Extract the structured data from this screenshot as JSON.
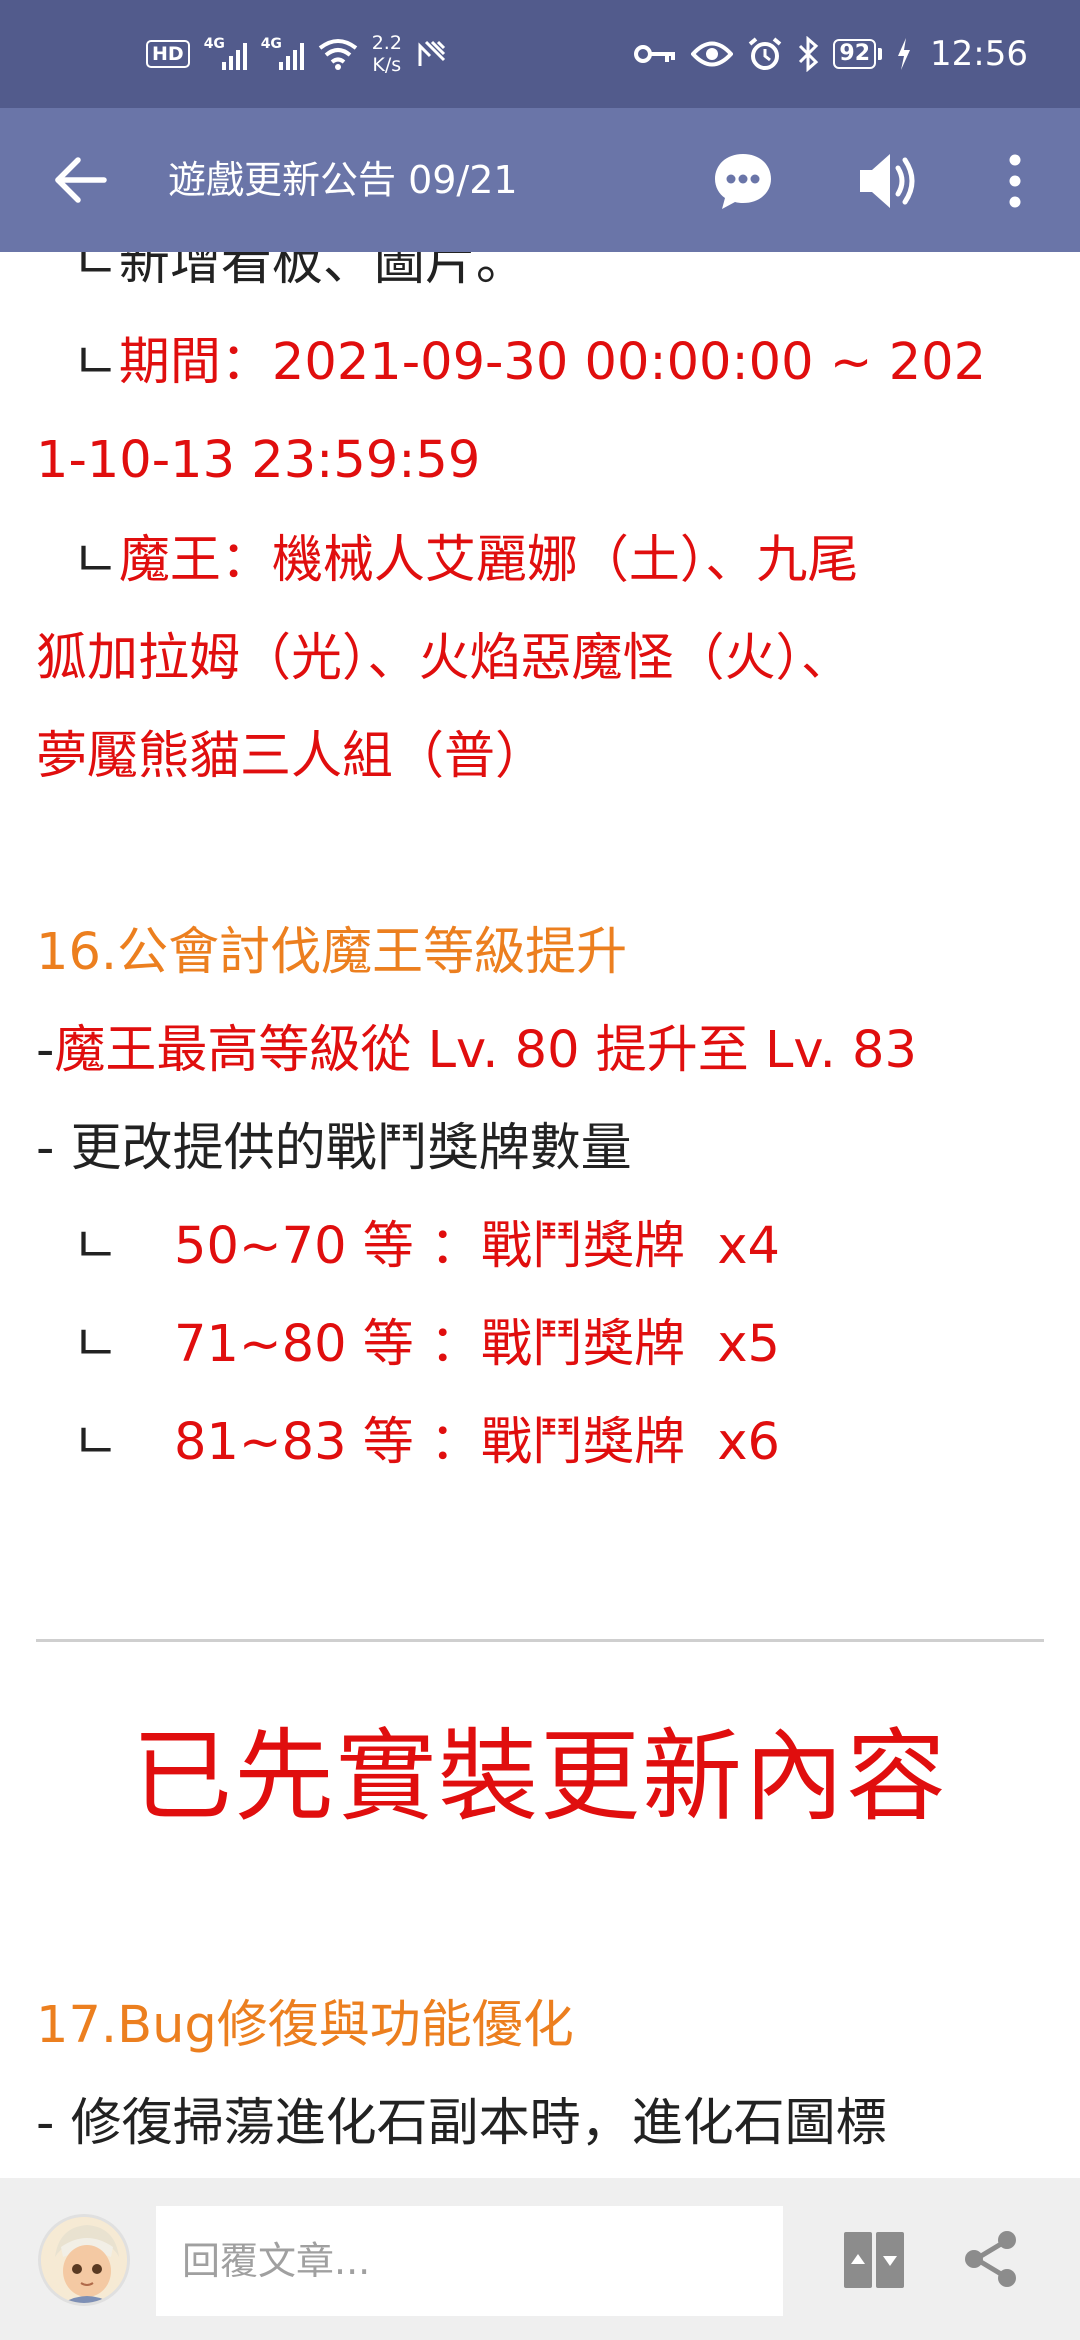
{
  "status_bar": {
    "hd_label": "HD",
    "sim1_label": "4G",
    "sim2_label": "4G",
    "speed_value": "2.2",
    "speed_unit": "K/s",
    "battery": "92",
    "time": "12:56"
  },
  "app_bar": {
    "title": "遊戲更新公告 09/21"
  },
  "article": {
    "partial_line": "ㄴ新增看板、圖片。",
    "period_prefix": "ㄴ",
    "period_line1": "期間：2021-09-30 00:00:00 ~ 202",
    "period_line2": "1-10-13 23:59:59",
    "boss_prefix": "ㄴ",
    "boss_line1": "魔王：機械人艾麗娜（土）、九尾",
    "boss_line2": "狐加拉姆（光）、火焰惡魔怪（火）、",
    "boss_line3": "夢魘熊貓三人組（普）",
    "section16_title": "16.公會討伐魔王等級提升",
    "item_max_level_dash": "- ",
    "item_max_level": "魔王最高等級從 Lv. 80 提升至 Lv. 83",
    "item_medals": "- 更改提供的戰鬥獎牌數量",
    "medal_rows": [
      {
        "prefix": "ㄴ",
        "text": "50~70 等 ：戰鬥獎牌  x4"
      },
      {
        "prefix": "ㄴ",
        "text": "71~80 等 ：戰鬥獎牌  x5"
      },
      {
        "prefix": "ㄴ",
        "text": "81~83 等 ：戰鬥獎牌  x6"
      }
    ],
    "big_heading": "已先實裝更新內容",
    "section17_title": "17.Bug修復與功能優化",
    "item_fix": "- 修復掃蕩進化石副本時，進化石圖標"
  },
  "bottom_bar": {
    "reply_placeholder": "回覆文章..."
  },
  "colors": {
    "status_bar_bg": "#525b8c",
    "app_bar_bg": "#6a75a8",
    "red_text": "#e00e0e",
    "orange_text": "#ec7f1f"
  },
  "icons": {
    "back": "arrow-left-icon",
    "chat": "chat-bubble-icon",
    "sound": "speaker-icon",
    "more": "more-vert-icon",
    "pager": "page-up-down-icon",
    "share": "share-icon"
  }
}
